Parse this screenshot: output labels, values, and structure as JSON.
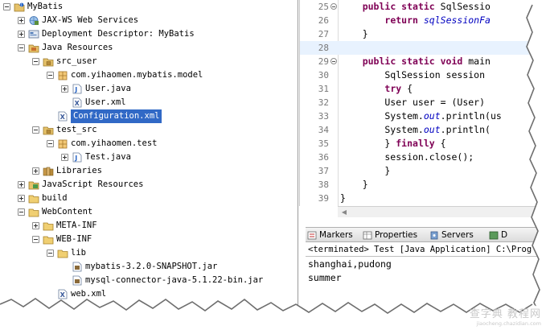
{
  "explorer": {
    "items": [
      {
        "label": "MyBatis",
        "level": 0,
        "expanded": true,
        "icon": "java-project-icon"
      },
      {
        "label": "JAX-WS Web Services",
        "level": 1,
        "expanded": false,
        "icon": "web-services-icon"
      },
      {
        "label": "Deployment Descriptor: MyBatis",
        "level": 1,
        "expanded": false,
        "icon": "deployment-descriptor-icon"
      },
      {
        "label": "Java Resources",
        "level": 1,
        "expanded": true,
        "icon": "java-resources-icon"
      },
      {
        "label": "src_user",
        "level": 2,
        "expanded": true,
        "icon": "source-folder-icon"
      },
      {
        "label": "com.yihaomen.mybatis.model",
        "level": 3,
        "expanded": true,
        "icon": "package-icon"
      },
      {
        "label": "User.java",
        "level": 4,
        "expanded": false,
        "icon": "java-file-icon"
      },
      {
        "label": "User.xml",
        "level": 4,
        "expanded": null,
        "icon": "xml-file-icon"
      },
      {
        "label": "Configuration.xml",
        "level": 3,
        "expanded": null,
        "icon": "xml-file-icon",
        "selected": true
      },
      {
        "label": "test_src",
        "level": 2,
        "expanded": true,
        "icon": "source-folder-icon"
      },
      {
        "label": "com.yihaomen.test",
        "level": 3,
        "expanded": true,
        "icon": "package-icon"
      },
      {
        "label": "Test.java",
        "level": 4,
        "expanded": false,
        "icon": "java-file-icon"
      },
      {
        "label": "Libraries",
        "level": 2,
        "expanded": false,
        "icon": "libraries-icon"
      },
      {
        "label": "JavaScript Resources",
        "level": 1,
        "expanded": false,
        "icon": "javascript-resources-icon"
      },
      {
        "label": "build",
        "level": 1,
        "expanded": false,
        "icon": "folder-icon"
      },
      {
        "label": "WebContent",
        "level": 1,
        "expanded": true,
        "icon": "folder-icon"
      },
      {
        "label": "META-INF",
        "level": 2,
        "expanded": false,
        "icon": "folder-icon"
      },
      {
        "label": "WEB-INF",
        "level": 2,
        "expanded": true,
        "icon": "folder-icon"
      },
      {
        "label": "lib",
        "level": 3,
        "expanded": true,
        "icon": "folder-icon"
      },
      {
        "label": "mybatis-3.2.0-SNAPSHOT.jar",
        "level": 4,
        "expanded": null,
        "icon": "jar-file-icon"
      },
      {
        "label": "mysql-connector-java-5.1.22-bin.jar",
        "level": 4,
        "expanded": null,
        "icon": "jar-file-icon"
      },
      {
        "label": "web.xml",
        "level": 3,
        "expanded": null,
        "icon": "xml-file-icon"
      }
    ]
  },
  "editor": {
    "lines": [
      {
        "num": "25",
        "fold": true,
        "tokens": [
          {
            "t": "    ",
            "c": ""
          },
          {
            "t": "public static",
            "c": "kw"
          },
          {
            "t": " SqlSessio",
            "c": ""
          }
        ]
      },
      {
        "num": "26",
        "fold": false,
        "tokens": [
          {
            "t": "        ",
            "c": ""
          },
          {
            "t": "return",
            "c": "kw"
          },
          {
            "t": " ",
            "c": ""
          },
          {
            "t": "sqlSessionFa",
            "c": "fld"
          }
        ]
      },
      {
        "num": "27",
        "fold": false,
        "tokens": [
          {
            "t": "    }",
            "c": ""
          }
        ]
      },
      {
        "num": "28",
        "fold": false,
        "current": true,
        "tokens": []
      },
      {
        "num": "29",
        "fold": true,
        "tokens": [
          {
            "t": "    ",
            "c": ""
          },
          {
            "t": "public static void",
            "c": "kw"
          },
          {
            "t": " main",
            "c": ""
          }
        ]
      },
      {
        "num": "30",
        "fold": false,
        "tokens": [
          {
            "t": "        SqlSession session",
            "c": ""
          }
        ]
      },
      {
        "num": "31",
        "fold": false,
        "tokens": [
          {
            "t": "        ",
            "c": ""
          },
          {
            "t": "try",
            "c": "kw"
          },
          {
            "t": " {",
            "c": ""
          }
        ]
      },
      {
        "num": "32",
        "fold": false,
        "tokens": [
          {
            "t": "        User user = (User)",
            "c": ""
          }
        ]
      },
      {
        "num": "33",
        "fold": false,
        "tokens": [
          {
            "t": "        System.",
            "c": ""
          },
          {
            "t": "out",
            "c": "fld"
          },
          {
            "t": ".println(us",
            "c": ""
          }
        ]
      },
      {
        "num": "34",
        "fold": false,
        "tokens": [
          {
            "t": "        System.",
            "c": ""
          },
          {
            "t": "out",
            "c": "fld"
          },
          {
            "t": ".println(",
            "c": ""
          }
        ]
      },
      {
        "num": "35",
        "fold": false,
        "tokens": [
          {
            "t": "        } ",
            "c": ""
          },
          {
            "t": "finally",
            "c": "kw"
          },
          {
            "t": " {",
            "c": ""
          }
        ]
      },
      {
        "num": "36",
        "fold": false,
        "tokens": [
          {
            "t": "        session.close();",
            "c": ""
          }
        ]
      },
      {
        "num": "37",
        "fold": false,
        "tokens": [
          {
            "t": "        }",
            "c": ""
          }
        ]
      },
      {
        "num": "38",
        "fold": false,
        "tokens": [
          {
            "t": "    }",
            "c": ""
          }
        ]
      },
      {
        "num": "39",
        "fold": false,
        "tokens": [
          {
            "t": "}",
            "c": ""
          }
        ]
      }
    ]
  },
  "console": {
    "tabs": [
      {
        "label": "Markers",
        "icon": "markers-icon"
      },
      {
        "label": "Properties",
        "icon": "properties-icon"
      },
      {
        "label": "Servers",
        "icon": "servers-icon"
      },
      {
        "label": "D",
        "icon": "data-source-icon"
      }
    ],
    "header": "<terminated> Test [Java Application] C:\\Prog",
    "output": [
      "shanghai,pudong",
      "summer"
    ]
  },
  "watermark": {
    "title": "查字典 教程网",
    "subtitle": "jiaocheng.chazidian.com"
  },
  "colors": {
    "selection": "#3169c6",
    "keyword": "#7f0055",
    "field": "#0000c0",
    "current_line": "#e8f2fe"
  }
}
